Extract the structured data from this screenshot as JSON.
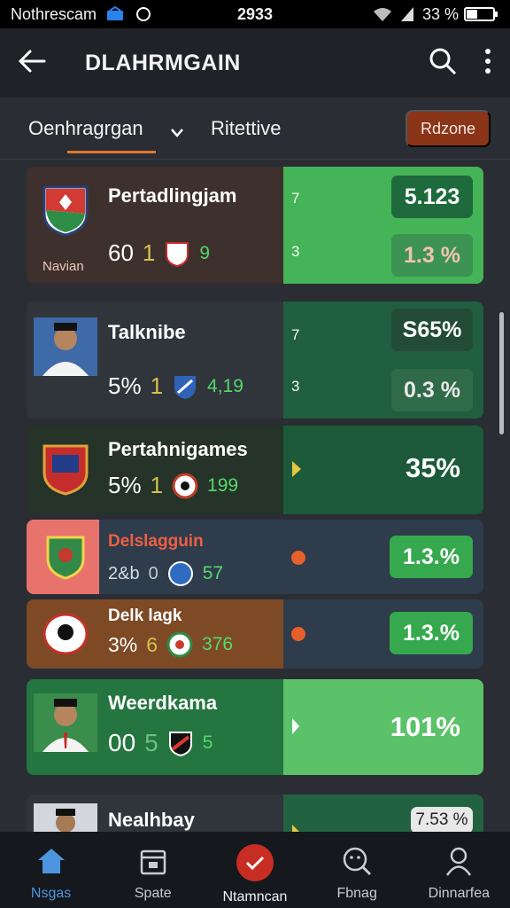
{
  "status_bar": {
    "carrier": "Nothrescam",
    "time": "2933",
    "battery": "33 %",
    "icons": [
      "signal-icon",
      "wifi-icon",
      "battery-icon"
    ]
  },
  "header": {
    "title": "DLAHRMGAIN",
    "icons": [
      "back-arrow-icon",
      "search-icon",
      "more-vertical-icon"
    ]
  },
  "tabs": [
    {
      "label": "Oenhragrgan",
      "active": true,
      "has_dropdown": true
    },
    {
      "label": "Ritettive",
      "active": false
    }
  ],
  "action_button": {
    "label": "Rdzone"
  },
  "colors": {
    "accent_orange": "#e0782c",
    "green_bright": "#55c16a",
    "green_dark": "#1f5f3f",
    "nav_active": "#4d95df",
    "center_red": "#c72d23"
  },
  "matches": [
    {
      "name": "Pertadlingjam",
      "subtitle": "Navian",
      "stat_a": "60",
      "stat_b": "1",
      "stat_d": "9",
      "num_top": "7",
      "num_bottom": "3",
      "pct_top": "5.123",
      "pct_bottom": "1.3 %"
    },
    {
      "name": "Talknibe",
      "stat_a": "5%",
      "stat_b": "1",
      "stat_d": "4,19",
      "num_top": "7",
      "num_bottom": "3",
      "pct_top": "S65%",
      "pct_bottom": "0.3 %"
    },
    {
      "name": "Pertahnigames",
      "stat_a": "5%",
      "stat_b": "1",
      "stat_d": "199",
      "pct_main": "35%"
    },
    {
      "name": "Delslagguin",
      "stat_a": "2&b",
      "stat_b": "0",
      "stat_d": "57",
      "pct_main": "1.3.%"
    },
    {
      "name": "Delk lagk",
      "stat_a": "3%",
      "stat_b": "6",
      "stat_d": "376",
      "pct_main": "1.3.%"
    },
    {
      "name": "Weerdkama",
      "stat_a": "00",
      "stat_b": "5",
      "stat_d": "5",
      "pct_main": "101%"
    },
    {
      "name": "Nealhbay",
      "pct_main": "7.53 %"
    }
  ],
  "bottom_nav": [
    {
      "label": "Nsgas",
      "icon": "home-icon",
      "active": true
    },
    {
      "label": "Spate",
      "icon": "calendar-icon",
      "active": false
    },
    {
      "label": "Ntamncan",
      "icon": "check-circle-icon",
      "active": false
    },
    {
      "label": "Fbnag",
      "icon": "face-search-icon",
      "active": false
    },
    {
      "label": "Dinnarfea",
      "icon": "profile-icon",
      "active": false
    }
  ]
}
